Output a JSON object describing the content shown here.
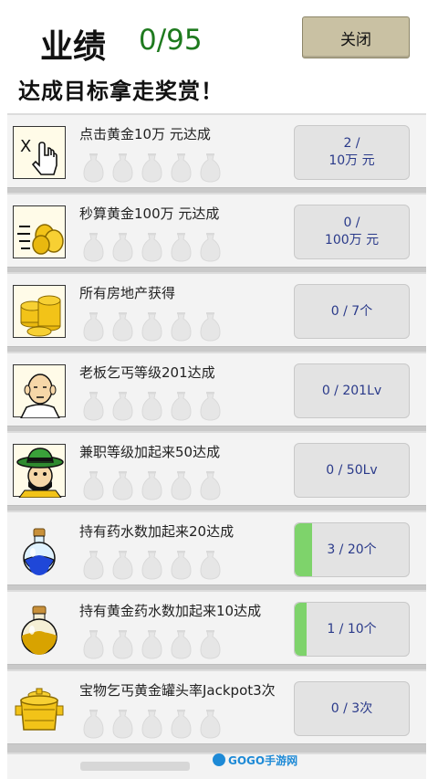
{
  "header": {
    "title": "业绩",
    "count": "0/95",
    "close_label": "关闭",
    "subtitle": "达成目标拿走奖赏！"
  },
  "achievements": [
    {
      "name": "点击黄金10万 元达成",
      "status_line1": "2 /",
      "status_line2": "10万 元",
      "progress": 0,
      "icon": "tap-finger-icon"
    },
    {
      "name": "秒算黄金100万 元达成",
      "status_line1": "0 /",
      "status_line2": "100万 元",
      "progress": 0,
      "icon": "gold-coins-speed-icon"
    },
    {
      "name": "所有房地产获得",
      "status_line1": "0 / 7个",
      "status_line2": "",
      "progress": 0,
      "icon": "gold-coin-stack-icon"
    },
    {
      "name": "老板乞丐等级201达成",
      "status_line1": "0 / 201Lv",
      "status_line2": "",
      "progress": 0,
      "icon": "bald-beggar-icon"
    },
    {
      "name": "兼职等级加起来50达成",
      "status_line1": "0 / 50Lv",
      "status_line2": "",
      "progress": 0,
      "icon": "green-hat-man-icon"
    },
    {
      "name": "持有药水数加起来20达成",
      "status_line1": "3 / 20个",
      "status_line2": "",
      "progress": 0.15,
      "icon": "blue-potion-icon"
    },
    {
      "name": "持有黄金药水数加起来10达成",
      "status_line1": "1 / 10个",
      "status_line2": "",
      "progress": 0.1,
      "icon": "gold-potion-icon"
    },
    {
      "name": "宝物乞丐黄金罐头率Jackpot3次",
      "status_line1": "0 / 3次",
      "status_line2": "",
      "progress": 0,
      "icon": "golden-pot-icon"
    }
  ],
  "watermark": "GOGO手游网",
  "colors": {
    "count": "#1e7a1e",
    "button": "#c9c1a3",
    "progress_fill": "#7ed36b",
    "status_text": "#2a3a8a"
  }
}
